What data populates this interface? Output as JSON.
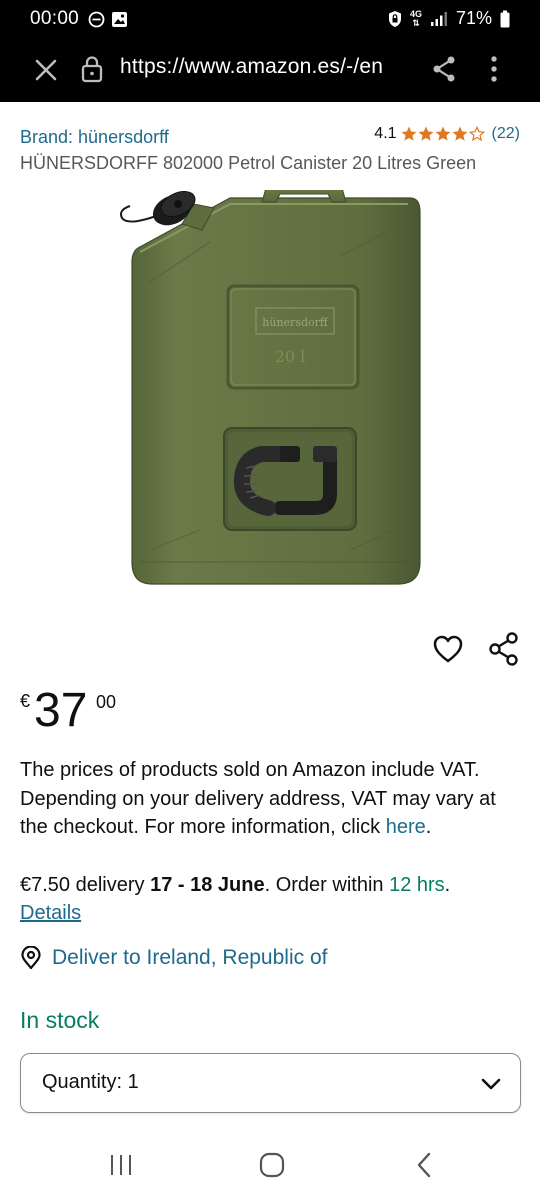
{
  "status_bar": {
    "time": "00:00",
    "network": "4G",
    "battery": "71%"
  },
  "browser": {
    "url": "https://www.amazon.es/-/en"
  },
  "product": {
    "brand": "Brand: hünersdorff",
    "rating_value": "4.1",
    "rating": 4.1,
    "rating_count": "(22)",
    "title": "HÜNERSDORFF 802000 Petrol Canister 20 Litres Green",
    "image_label": "hünersdorff",
    "image_volume": "20 l",
    "colors": {
      "canister": "#5c6b3e",
      "link": "#1f6a8c",
      "stock": "#067d62",
      "stars": "#de7921"
    }
  },
  "price": {
    "symbol": "€",
    "whole": "37",
    "fraction": "00"
  },
  "vat_notice": {
    "text": "The prices of products sold on Amazon include VAT. Depending on your delivery address, VAT may vary at the checkout. For more information, click ",
    "link": "here",
    "suffix": "."
  },
  "delivery": {
    "cost": "€7.50 delivery ",
    "dates": "17 - 18 June",
    "order_within": ". Order within ",
    "time_left": "12 hrs",
    "end": ".",
    "details_link": "Details"
  },
  "location": {
    "label": "Deliver to Ireland, Republic of"
  },
  "availability": "In stock",
  "quantity": {
    "label": "Quantity: 1"
  }
}
